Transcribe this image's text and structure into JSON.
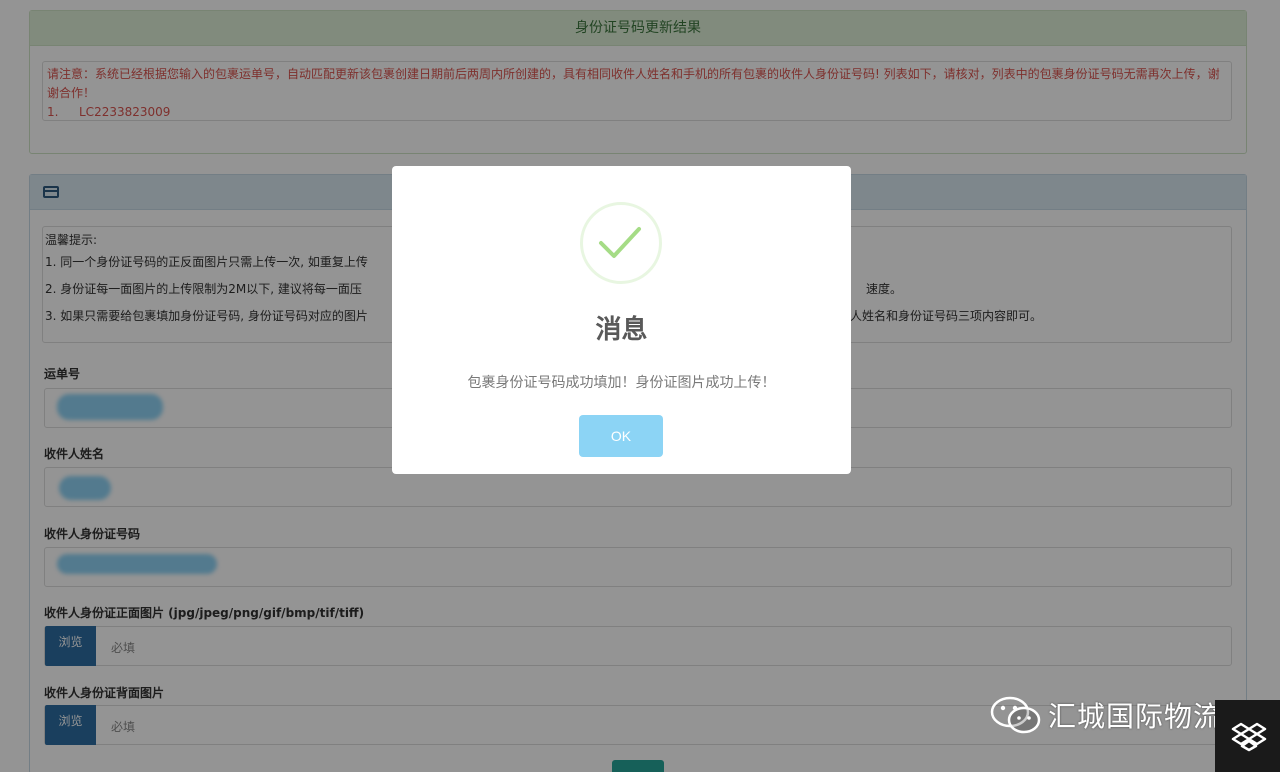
{
  "result_panel": {
    "title": "身份证号码更新结果",
    "notice": "请注意：系统已经根据您输入的包裹运单号，自动匹配更新该包裹创建日期前后两周内所创建的，具有相同收件人姓名和手机的所有包裹的收件人身份证号码! 列表如下，请核对，列表中的包裹身份证号码无需再次上传，谢谢合作！",
    "items": [
      {
        "index": "1.",
        "tracking": "LC2233823009"
      }
    ]
  },
  "upload_panel": {
    "tips": {
      "title": "温馨提示:",
      "line1": "1. 同一个身份证号码的正反面图片只需上传一次, 如重复上传",
      "line2": "2. 身份证每一面图片的上传限制为2M以下, 建议将每一面压",
      "line2_tail": "速度。",
      "line3": "3. 如果只需要给包裹填加身份证号码, 身份证号码对应的图片",
      "line3_tail": "人姓名和身份证号码三项内容即可。"
    },
    "fields": {
      "tracking_label": "运单号",
      "name_label": "收件人姓名",
      "id_label": "收件人身份证号码",
      "front_label": "收件人身份证正面图片 (jpg/jpeg/png/gif/bmp/tif/tiff)",
      "back_label": "收件人身份证背面图片",
      "browse_label": "浏览",
      "required_placeholder": "必填"
    }
  },
  "modal": {
    "title": "消息",
    "message": "包裹身份证号码成功填加！身份证图片成功上传！",
    "ok_label": "OK"
  },
  "watermark": {
    "text": "汇城国际物流"
  },
  "colors": {
    "success_header_bg": "#dff0d8",
    "notice_text": "#d9534f",
    "info_header_bg": "#d9e8f2",
    "browse_button": "#2d6da3",
    "ok_button": "#8cd4f5",
    "check_mark": "#a5dc86"
  }
}
